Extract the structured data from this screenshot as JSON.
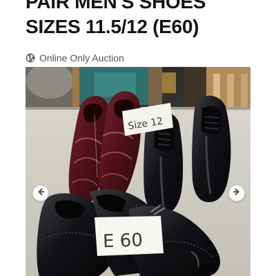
{
  "listing": {
    "title_line1": "PAIR MEN'S SHOES",
    "title_line2": "SIZES 11.5/12 (E60)",
    "auction_type": "Online Only Auction",
    "auction_icon": "globe-icon"
  },
  "photo": {
    "size_note": "Size 12",
    "lot_note": "E 60",
    "prev_icon": "arrow-left-icon",
    "next_icon": "arrow-right-icon"
  },
  "colors": {
    "title": "#151515",
    "meta_text": "#555555",
    "burgundy_shoe": "#5a1520",
    "black_shoe": "#121214"
  }
}
